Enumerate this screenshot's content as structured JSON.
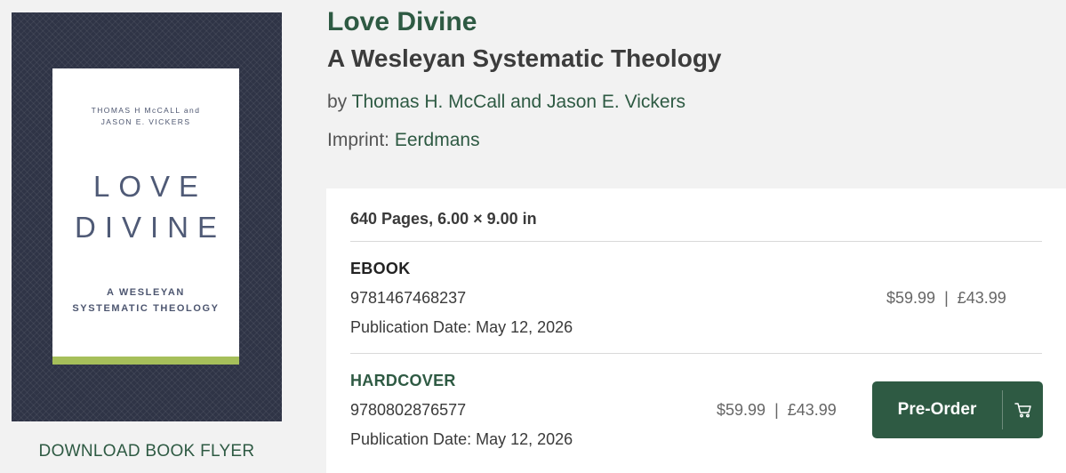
{
  "cover": {
    "authors_line1": "THOMAS H McCALL and",
    "authors_line2": "JASON E. VICKERS",
    "title_line1": "LOVE",
    "title_line2": "DIVINE",
    "subtitle_line1": "A WESLEYAN",
    "subtitle_line2": "SYSTEMATIC THEOLOGY"
  },
  "flyer_link": "DOWNLOAD BOOK FLYER",
  "book": {
    "title": "Love Divine",
    "subtitle": "A Wesleyan Systematic Theology",
    "by_prefix": "by ",
    "authors": "Thomas H. McCall and Jason E. Vickers",
    "imprint_label": "Imprint: ",
    "imprint": "Eerdmans"
  },
  "specs": "640 Pages, 6.00 × 9.00 in",
  "formats": [
    {
      "label": "EBOOK",
      "isbn": "9781467468237",
      "pub_date": "Publication Date: May 12, 2026",
      "price_usd": "$59.99",
      "price_gbp": "£43.99",
      "separator": "|"
    },
    {
      "label": "HARDCOVER",
      "isbn": "9780802876577",
      "pub_date": "Publication Date: May 12, 2026",
      "price_usd": "$59.99",
      "price_gbp": "£43.99",
      "separator": "|",
      "button_label": "Pre-Order"
    }
  ],
  "colors": {
    "accent": "#2e5a43",
    "cover_bg": "#2f3446",
    "cover_band": "#a6bf5a"
  },
  "icons": {
    "cart": "shopping-cart-icon"
  }
}
